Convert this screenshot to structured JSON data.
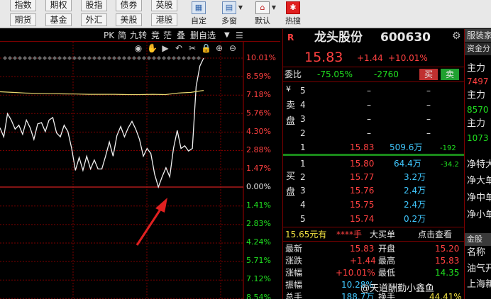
{
  "toolbar": {
    "row1": [
      "指数",
      "期权",
      "股指",
      "债券",
      "英股",
      "港股"
    ],
    "row2": [
      "期货",
      "基金",
      "外汇",
      "美股",
      "港股"
    ],
    "big": [
      {
        "label": "自定",
        "icon": "grid-icon"
      },
      {
        "label": "多窗",
        "icon": "window-icon"
      },
      {
        "label": "默认",
        "icon": "home-icon"
      },
      {
        "label": "热搜",
        "icon": "hot-icon"
      }
    ]
  },
  "chart": {
    "tabs": [
      "PK",
      "简",
      "九转",
      "竞",
      "茫",
      "叠",
      "删自选"
    ],
    "y_labels_up": [
      "10.01%",
      "8.59%",
      "7.18%",
      "5.76%",
      "4.30%",
      "2.88%",
      "1.47%"
    ],
    "y_label_zero": "0.00%",
    "y_labels_down": [
      "1.41%",
      "2.83%",
      "4.24%",
      "5.71%",
      "7.12%",
      "8.54%"
    ]
  },
  "chart_data": {
    "type": "line",
    "title": "",
    "ylabel": "",
    "xlabel": "",
    "ylim": [
      -10.0,
      10.01
    ],
    "series": [
      {
        "values": [
          4.6,
          3.9,
          5.7,
          5.2,
          4.5,
          4.8,
          4.1,
          5.2,
          4.6,
          3.7,
          4.9,
          5.0,
          4.3,
          5.2,
          5.4,
          4.2,
          3.9,
          4.8,
          4.3,
          3.0,
          1.3,
          2.3,
          1.3,
          2.4,
          1.4,
          2.1,
          1.4,
          1.4,
          2.4,
          3.5,
          2.4,
          4.0,
          4.7,
          3.9,
          4.6,
          5.1,
          4.5,
          3.7,
          2.4,
          3.0,
          2.6,
          1.0,
          0.0,
          0.8,
          1.5,
          0.8,
          3.0,
          4.4,
          3.0,
          3.2,
          2.8,
          3.0,
          7.8,
          9.4,
          10.01
        ]
      },
      {
        "values": [
          7.4,
          7.35,
          7.3,
          7.27,
          7.25,
          7.23,
          7.22,
          7.2,
          7.2,
          7.2,
          7.18,
          7.18,
          7.2,
          7.18,
          7.3,
          7.35,
          7.5
        ]
      }
    ]
  },
  "quote": {
    "r_mark": "R",
    "name": "龙头股份",
    "code": "600630",
    "price": "15.83",
    "change": "+1.44",
    "change_pct": "+10.01%",
    "webi_label": "委比",
    "webi_pct": "-75.05%",
    "webi_diff": "-2760",
    "buy_btn": "买",
    "sell_btn": "卖",
    "sell_side_label": "卖盘",
    "buy_side_label": "买盘",
    "currency_mark": "¥",
    "sell_orders": [
      {
        "level": "5",
        "price": "–",
        "vol": "–"
      },
      {
        "level": "4",
        "price": "–",
        "vol": "–"
      },
      {
        "level": "3",
        "price": "–",
        "vol": "–"
      },
      {
        "level": "2",
        "price": "–",
        "vol": "–"
      },
      {
        "level": "1",
        "price": "15.83",
        "vol": "509.6万",
        "chg": "-192"
      }
    ],
    "buy_orders": [
      {
        "level": "1",
        "price": "15.80",
        "vol": "64.4万",
        "chg": "-34.2"
      },
      {
        "level": "2",
        "price": "15.77",
        "vol": "3.2万"
      },
      {
        "level": "3",
        "price": "15.76",
        "vol": "2.4万"
      },
      {
        "level": "4",
        "price": "15.75",
        "vol": "2.4万"
      },
      {
        "level": "5",
        "price": "15.74",
        "vol": "0.2万"
      }
    ],
    "big_order_price": "15.65元有",
    "big_order_qty": "****手",
    "big_order_label": "大买单",
    "big_order_link": "点击查看",
    "stats_left": [
      {
        "label": "最新",
        "value": "15.83"
      },
      {
        "label": "涨跌",
        "value": "+1.44"
      },
      {
        "label": "涨幅",
        "value": "+10.01%"
      },
      {
        "label": "振幅",
        "value": "10.28%"
      },
      {
        "label": "总手",
        "value": "188.7万"
      }
    ],
    "stats_right": [
      {
        "label": "开盘",
        "value": "15.20"
      },
      {
        "label": "最高",
        "value": "15.83"
      },
      {
        "label": "最低",
        "value": "14.35"
      },
      {
        "label": "换手",
        "value": "44.41%"
      }
    ]
  },
  "side": {
    "tab1": "服装家",
    "tab2": "资金分",
    "items": [
      {
        "label": "主力",
        "value": "7497"
      },
      {
        "label": "主力",
        "value": "8570"
      },
      {
        "label": "主力",
        "value": "1073"
      }
    ],
    "flow": [
      "净特大",
      "净大单",
      "净中单",
      "净小单"
    ],
    "tab3": "金股",
    "rows2": [
      "名称",
      "油气开",
      "上海新"
    ]
  },
  "watermark": "@天道酬勤小鑫鱼"
}
